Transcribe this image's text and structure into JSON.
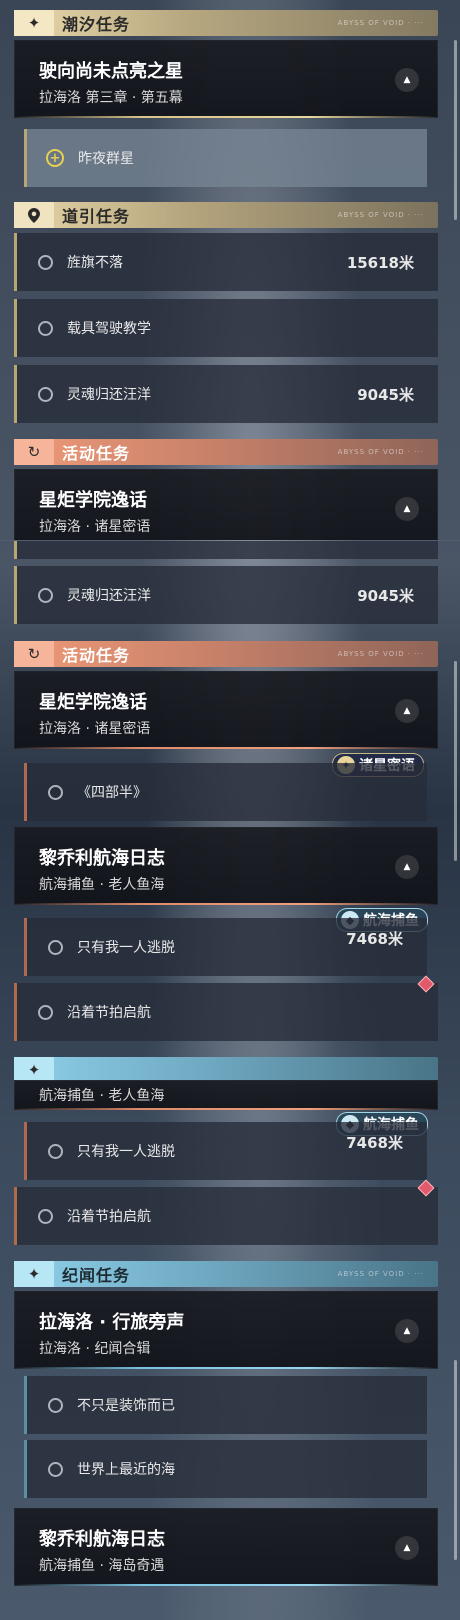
{
  "sections": {
    "tide": "潮汐任务",
    "guide": "道引任务",
    "event": "活动任务",
    "lore": "纪闻任务"
  },
  "header_deco": "ABYSS OF VOID · ···",
  "collapse_glyph": "▲",
  "quests": {
    "main": {
      "title": "驶向尚未点亮之星",
      "subtitle": "拉海洛 第三章 · 第五幕"
    },
    "selected_step": "昨夜群星",
    "guide_steps": [
      {
        "label": "旌旗不落",
        "distance": "15618米"
      },
      {
        "label": "载具驾驶教学",
        "distance": ""
      },
      {
        "label": "灵魂归还汪洋",
        "distance": "9045米"
      }
    ],
    "academy": {
      "title": "星炬学院逸话",
      "subtitle": "拉海洛 · 诸星密语",
      "steps": [
        "《四部半》"
      ],
      "badge": "诸星密语"
    },
    "logbook1": {
      "title": "黎乔利航海日志",
      "subtitle": "航海捕鱼 · 老人鱼海",
      "steps": [
        {
          "label": "只有我一人逃脱",
          "distance": "7468米"
        },
        {
          "label": "沿着节拍启航",
          "distance": ""
        }
      ],
      "badge": "航海捕鱼"
    },
    "lore_main": {
      "title": "拉海洛 · 行旅旁声",
      "subtitle": "拉海洛 · 纪闻合辑",
      "steps": [
        "不只是装饰而已",
        "世界上最近的海"
      ]
    },
    "logbook2": {
      "title": "黎乔利航海日志",
      "subtitle": "航海捕鱼 · 海岛奇遇"
    }
  },
  "icons": {
    "tide": "sparkle-icon",
    "guide": "map-pin-icon",
    "event": "refresh-icon",
    "lore": "sparkle-icon"
  }
}
